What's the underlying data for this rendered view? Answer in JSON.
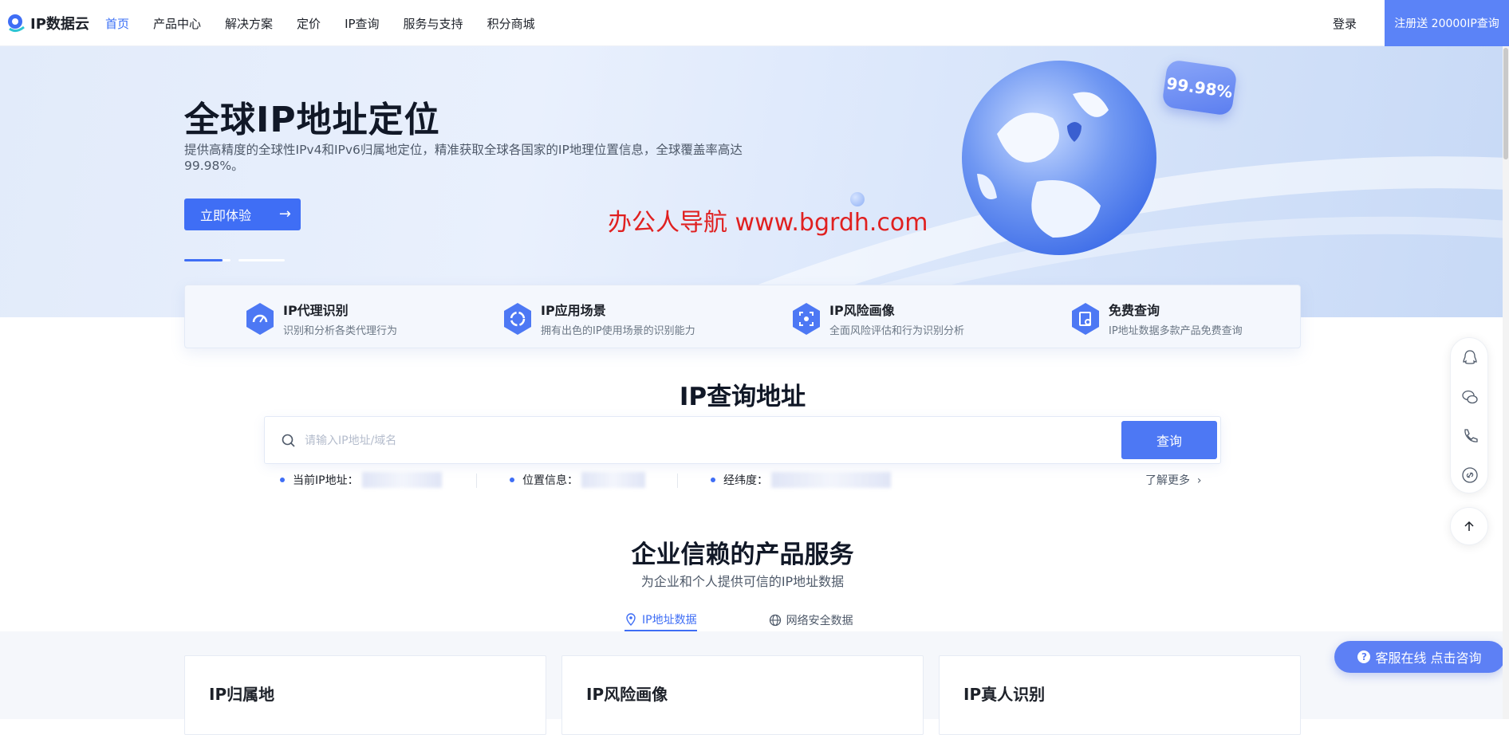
{
  "nav": {
    "logo_text": "IP数据云",
    "links": [
      "首页",
      "产品中心",
      "解决方案",
      "定价",
      "IP查询",
      "服务与支持",
      "积分商城"
    ],
    "login": "登录",
    "register": "注册送 20000IP查询"
  },
  "hero": {
    "title": "全球IP地址定位",
    "desc": "提供高精度的全球性IPv4和IPv6归属地定位，精准获取全球各国家的IP地理位置信息，全球覆盖率高达99.98%。",
    "button": "立即体验",
    "badge": "99.98%",
    "watermark": "办公人导航  www.bgrdh.com"
  },
  "features": [
    {
      "title": "IP代理识别",
      "sub": "识别和分析各类代理行为",
      "icon": "gauge-icon"
    },
    {
      "title": "IP应用场景",
      "sub": "拥有出色的IP使用场景的识别能力",
      "icon": "refresh-icon"
    },
    {
      "title": "IP风险画像",
      "sub": "全面风险评估和行为识别分析",
      "icon": "scan-icon"
    },
    {
      "title": "免费查询",
      "sub": "IP地址数据多款产品免费查询",
      "icon": "search-doc-icon"
    }
  ],
  "search": {
    "title": "IP查询地址",
    "placeholder": "请输入IP地址/域名",
    "button": "查询",
    "info": [
      {
        "label": "当前IP地址："
      },
      {
        "label": "位置信息："
      },
      {
        "label": "经纬度："
      }
    ],
    "more": "了解更多"
  },
  "products": {
    "title": "企业信赖的产品服务",
    "subtitle": "为企业和个人提供可信的IP地址数据",
    "tabs": [
      {
        "label": "IP地址数据",
        "active": true
      },
      {
        "label": "网络安全数据",
        "active": false
      }
    ],
    "cards": [
      "IP归属地",
      "IP风险画像",
      "IP真人识别"
    ]
  },
  "float": {
    "icons": [
      "qq-icon",
      "wechat-icon",
      "phone-icon",
      "link-icon"
    ],
    "chat": "客服在线 点击咨询"
  },
  "colors": {
    "accent": "#3f6ef5",
    "register_bg": "#5b83f7",
    "watermark": "#e02020"
  }
}
